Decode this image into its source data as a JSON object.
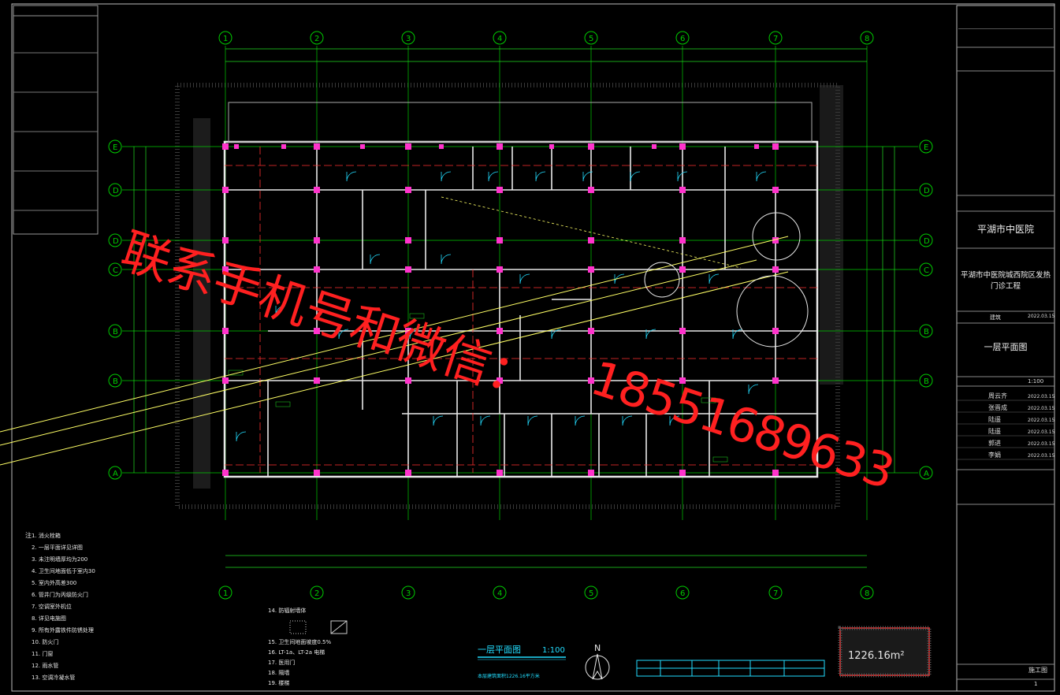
{
  "drawing": {
    "title_block": {
      "project_owner": "平湖市中医院",
      "project_name": "平湖市中医院城西院区发热门诊工程",
      "drawing_name": "一层平面图",
      "specialty": "建筑",
      "date": "2022.03.15",
      "scale": "1:100",
      "signatures": [
        {
          "name": "周云齐",
          "date": "2022.03.15"
        },
        {
          "name": "张晋成",
          "date": "2022.03.15"
        },
        {
          "name": "陆遥",
          "date": "2022.03.15"
        },
        {
          "name": "陆遥",
          "date": "2022.03.15"
        },
        {
          "name": "郭进",
          "date": "2022.03.15"
        },
        {
          "name": "李娟",
          "date": "2022.03.15"
        }
      ],
      "sheet_label": "施工图",
      "sheet_no": "1"
    },
    "plan_title": "一层平面图",
    "plan_scale": "1:100",
    "plan_note": "本层建筑面积1226.16平方米",
    "north_label": "N",
    "area_value": "1226.16m²",
    "axis_labels_top": [
      "1",
      "2",
      "3",
      "4",
      "5",
      "6",
      "7",
      "8"
    ],
    "axis_labels_left": [
      "E",
      "D",
      "D",
      "C",
      "B",
      "B",
      "A"
    ],
    "notes_header": "注",
    "notes": [
      "1. 消火栓箱",
      "2. 一层平面详见详图",
      "3. 未注明墙厚均为200",
      "4. 卫生间地面低于室内30",
      "5. 室内外高差300",
      "6. 管井门为丙级防火门",
      "7. 空调室外机位",
      "8. 详见电施图",
      "9. 所有外露铁件防锈处理",
      "10. 防火门",
      "11. 门窗",
      "12. 雨水管",
      "13. 空调冷凝水管"
    ],
    "legend_title": "14. 防辐射墙体",
    "legend_notes": [
      "15. 卫生间地面坡度0.5%",
      "16. LT-1a、LT-2a 电梯",
      "17. 医用门",
      "18. 隔墙",
      "19. 楼梯"
    ]
  },
  "watermark": {
    "line1": "联系手机号和微信：",
    "line2": "18551689633"
  },
  "colors": {
    "background": "#000000",
    "axis_green": "#00cc00",
    "wall_white": "#e8e8e8",
    "column_magenta": "#ff33cc",
    "dimension_green": "#22dd22",
    "door_cyan": "#22ddff",
    "red_line": "#ff3030",
    "yellow": "#ffff33",
    "watermark_red": "#ff1a1a"
  }
}
